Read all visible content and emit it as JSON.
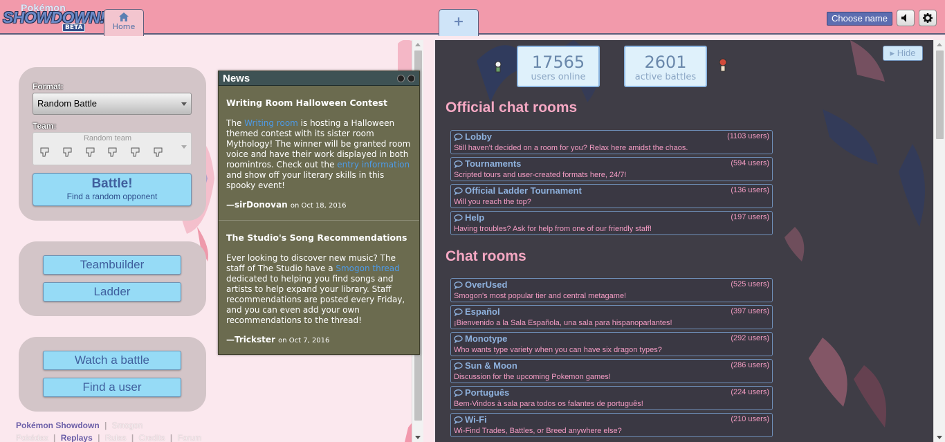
{
  "header": {
    "logo_line1": "Pokémon",
    "logo_line2": "SHOWDOWN!",
    "logo_beta": "BETA",
    "home_tab": "Home",
    "new_tab": "+",
    "choose_name": "Choose name",
    "sound_icon": "speaker-icon",
    "settings_icon": "gear-icon"
  },
  "main_menu": {
    "format_label": "Format:",
    "format_value": "Random Battle",
    "team_label": "Team:",
    "team_value": "Random team",
    "battle_label": "Battle!",
    "battle_sub": "Find a random opponent",
    "teambuilder": "Teambuilder",
    "ladder": "Ladder",
    "watch": "Watch a battle",
    "find_user": "Find a user"
  },
  "footer": {
    "links": [
      "Pokémon Showdown",
      "Smogon",
      "Pokédex",
      "Replays",
      "Rules",
      "Credits",
      "Forum"
    ],
    "sep": "|"
  },
  "news": {
    "title": "News",
    "items": [
      {
        "title": "Writing Room Halloween Contest",
        "t1": "The ",
        "link1": "Writing room",
        "t2": " is hosting a Halloween themed contest with its sister room Mythology! The winner will be granted room voice and have their work displayed in both roomintros. Check out the ",
        "link2": "entry information",
        "t3": " and show off your literary skills in this spooky event!",
        "author": "—sirDonovan",
        "date": "on Oct 18, 2016"
      },
      {
        "title": "The Studio's Song Recommendations",
        "t1": "Ever looking to discover new music? The staff of The Studio have a ",
        "link1": "Smogon thread",
        "t2": " dedicated to helping you find songs and artists to help expand your library. Staff recommendations are posted every Friday, and you can even add your own recommendations to the thread!",
        "author": "—Trickster",
        "date": "on Oct 7, 2016"
      }
    ]
  },
  "stats": {
    "users": "17565",
    "users_label": "users online",
    "battles": "2601",
    "battles_label": "active battles",
    "hide": "Hide"
  },
  "official_title": "Official chat rooms",
  "official_rooms": [
    {
      "name": "Lobby",
      "users": "(1103 users)",
      "desc": "Still haven't decided on a room for you? Relax here amidst the chaos."
    },
    {
      "name": "Tournaments",
      "users": "(594 users)",
      "desc": "Scripted tours and user-created formats here, 24/7!"
    },
    {
      "name": "Official Ladder Tournament",
      "users": "(136 users)",
      "desc": "Will you reach the top?"
    },
    {
      "name": "Help",
      "users": "(197 users)",
      "desc": "Having troubles? Ask for help from one of our friendly staff!"
    }
  ],
  "chat_title": "Chat rooms",
  "chat_rooms": [
    {
      "name": "OverUsed",
      "users": "(525 users)",
      "desc": "Smogon's most popular tier and central metagame!"
    },
    {
      "name": "Español",
      "users": "(397 users)",
      "desc": "¡Bienvenido a la Sala Española, una sala para hispanoparlantes!"
    },
    {
      "name": "Monotype",
      "users": "(292 users)",
      "desc": "Who wants type variety when you can have six dragon types?"
    },
    {
      "name": "Sun & Moon",
      "users": "(286 users)",
      "desc": "Discussion for the upcoming Pokemon games!"
    },
    {
      "name": "Português",
      "users": "(224 users)",
      "desc": "Bem-Vindos à sala para todos os falantes de português!"
    },
    {
      "name": "Wi-Fi",
      "users": "(210 users)",
      "desc": "Wi-Find Trades, Battles, or Breed anywhere else?"
    }
  ]
}
